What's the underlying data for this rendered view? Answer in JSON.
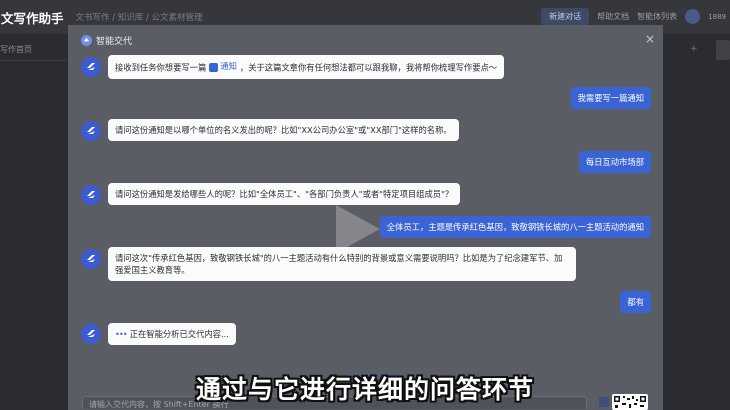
{
  "header": {
    "app_title": "文写作助手",
    "subtitle": "文书写作 / 知识库 / 公文素材管理",
    "pill_label": "新建对话",
    "link1": "帮助文档",
    "link2": "智能体列表",
    "user_label": "1889"
  },
  "sidebar": {
    "item": "写作首页"
  },
  "modal": {
    "title": "智能交代",
    "close": "×"
  },
  "messages": [
    {
      "role": "bot",
      "pre": "接收到任务你想要写一篇",
      "chip": "通知",
      "post": "，关于这篇文章你有任何想法都可以跟我聊，我将帮你梳理写作要点～"
    },
    {
      "role": "user",
      "text": "我需要写一篇通知"
    },
    {
      "role": "bot",
      "text": "请问这份通知是以哪个单位的名义发出的呢？比如\"XX公司办公室\"或\"XX部门\"这样的名称。"
    },
    {
      "role": "user",
      "text": "每日互动市场部"
    },
    {
      "role": "bot",
      "text": "请问这份通知是发给哪些人的呢？比如\"全体员工\"、\"各部门负责人\"或者\"特定项目组成员\"？"
    },
    {
      "role": "user",
      "text": "全体员工，主题是传承红色基因，致敬钢铁长城的八一主题活动的通知"
    },
    {
      "role": "bot",
      "text": "请问这次\"传承红色基因，致敬钢铁长城\"的八一主题活动有什么特别的背景或意义需要说明吗？比如是为了纪念建军节、加强爱国主义教育等。"
    },
    {
      "role": "user",
      "text": "都有"
    },
    {
      "role": "bot",
      "loading": "•••",
      "text": "正在智能分析已交代内容..."
    }
  ],
  "input": {
    "placeholder": "请输入交代内容，按 Shift+Enter 换行"
  },
  "video_subtitle": "通过与它进行详细的问答环节",
  "colors": {
    "accent": "#3a63d6",
    "modal_bg": "#5a5d63",
    "page_bg": "#2a2c31"
  }
}
